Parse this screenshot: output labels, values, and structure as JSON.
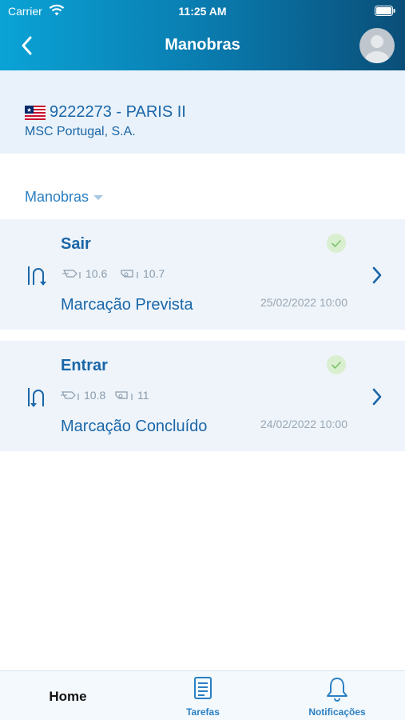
{
  "status_bar": {
    "carrier": "Carrier",
    "time": "11:25 AM"
  },
  "header": {
    "title": "Manobras",
    "back_icon": "chevron-left-icon",
    "avatar_icon": "user-avatar-icon"
  },
  "vessel": {
    "flag": "liberia-flag-icon",
    "title": "9222273 - PARIS II",
    "company": "MSC Portugal, S.A."
  },
  "filter": {
    "label": "Manobras"
  },
  "cards": [
    {
      "title": "Sair",
      "status_icon": "check-icon",
      "direction_icon": "unberth-icon",
      "draft_fore": "10.6",
      "draft_aft": "10.7",
      "status": "Marcação Prevista",
      "date": "25/02/2022 10:00"
    },
    {
      "title": "Entrar",
      "status_icon": "check-icon",
      "direction_icon": "berth-icon",
      "draft_fore": "10.8",
      "draft_aft": "11",
      "status": "Marcação Concluído",
      "date": "24/02/2022 10:00"
    }
  ],
  "tabs": [
    {
      "label": "Home",
      "active": true
    },
    {
      "label": "Tarefas",
      "icon": "document-icon"
    },
    {
      "label": "Notificações",
      "icon": "bell-icon"
    }
  ],
  "colors": {
    "accent": "#1a66a8",
    "header_start": "#0aa3d6",
    "header_end": "#0a4e78",
    "panel_bg": "#e9f2fa",
    "card_bg": "#eef4fa",
    "check_bg": "#d9efcf"
  }
}
